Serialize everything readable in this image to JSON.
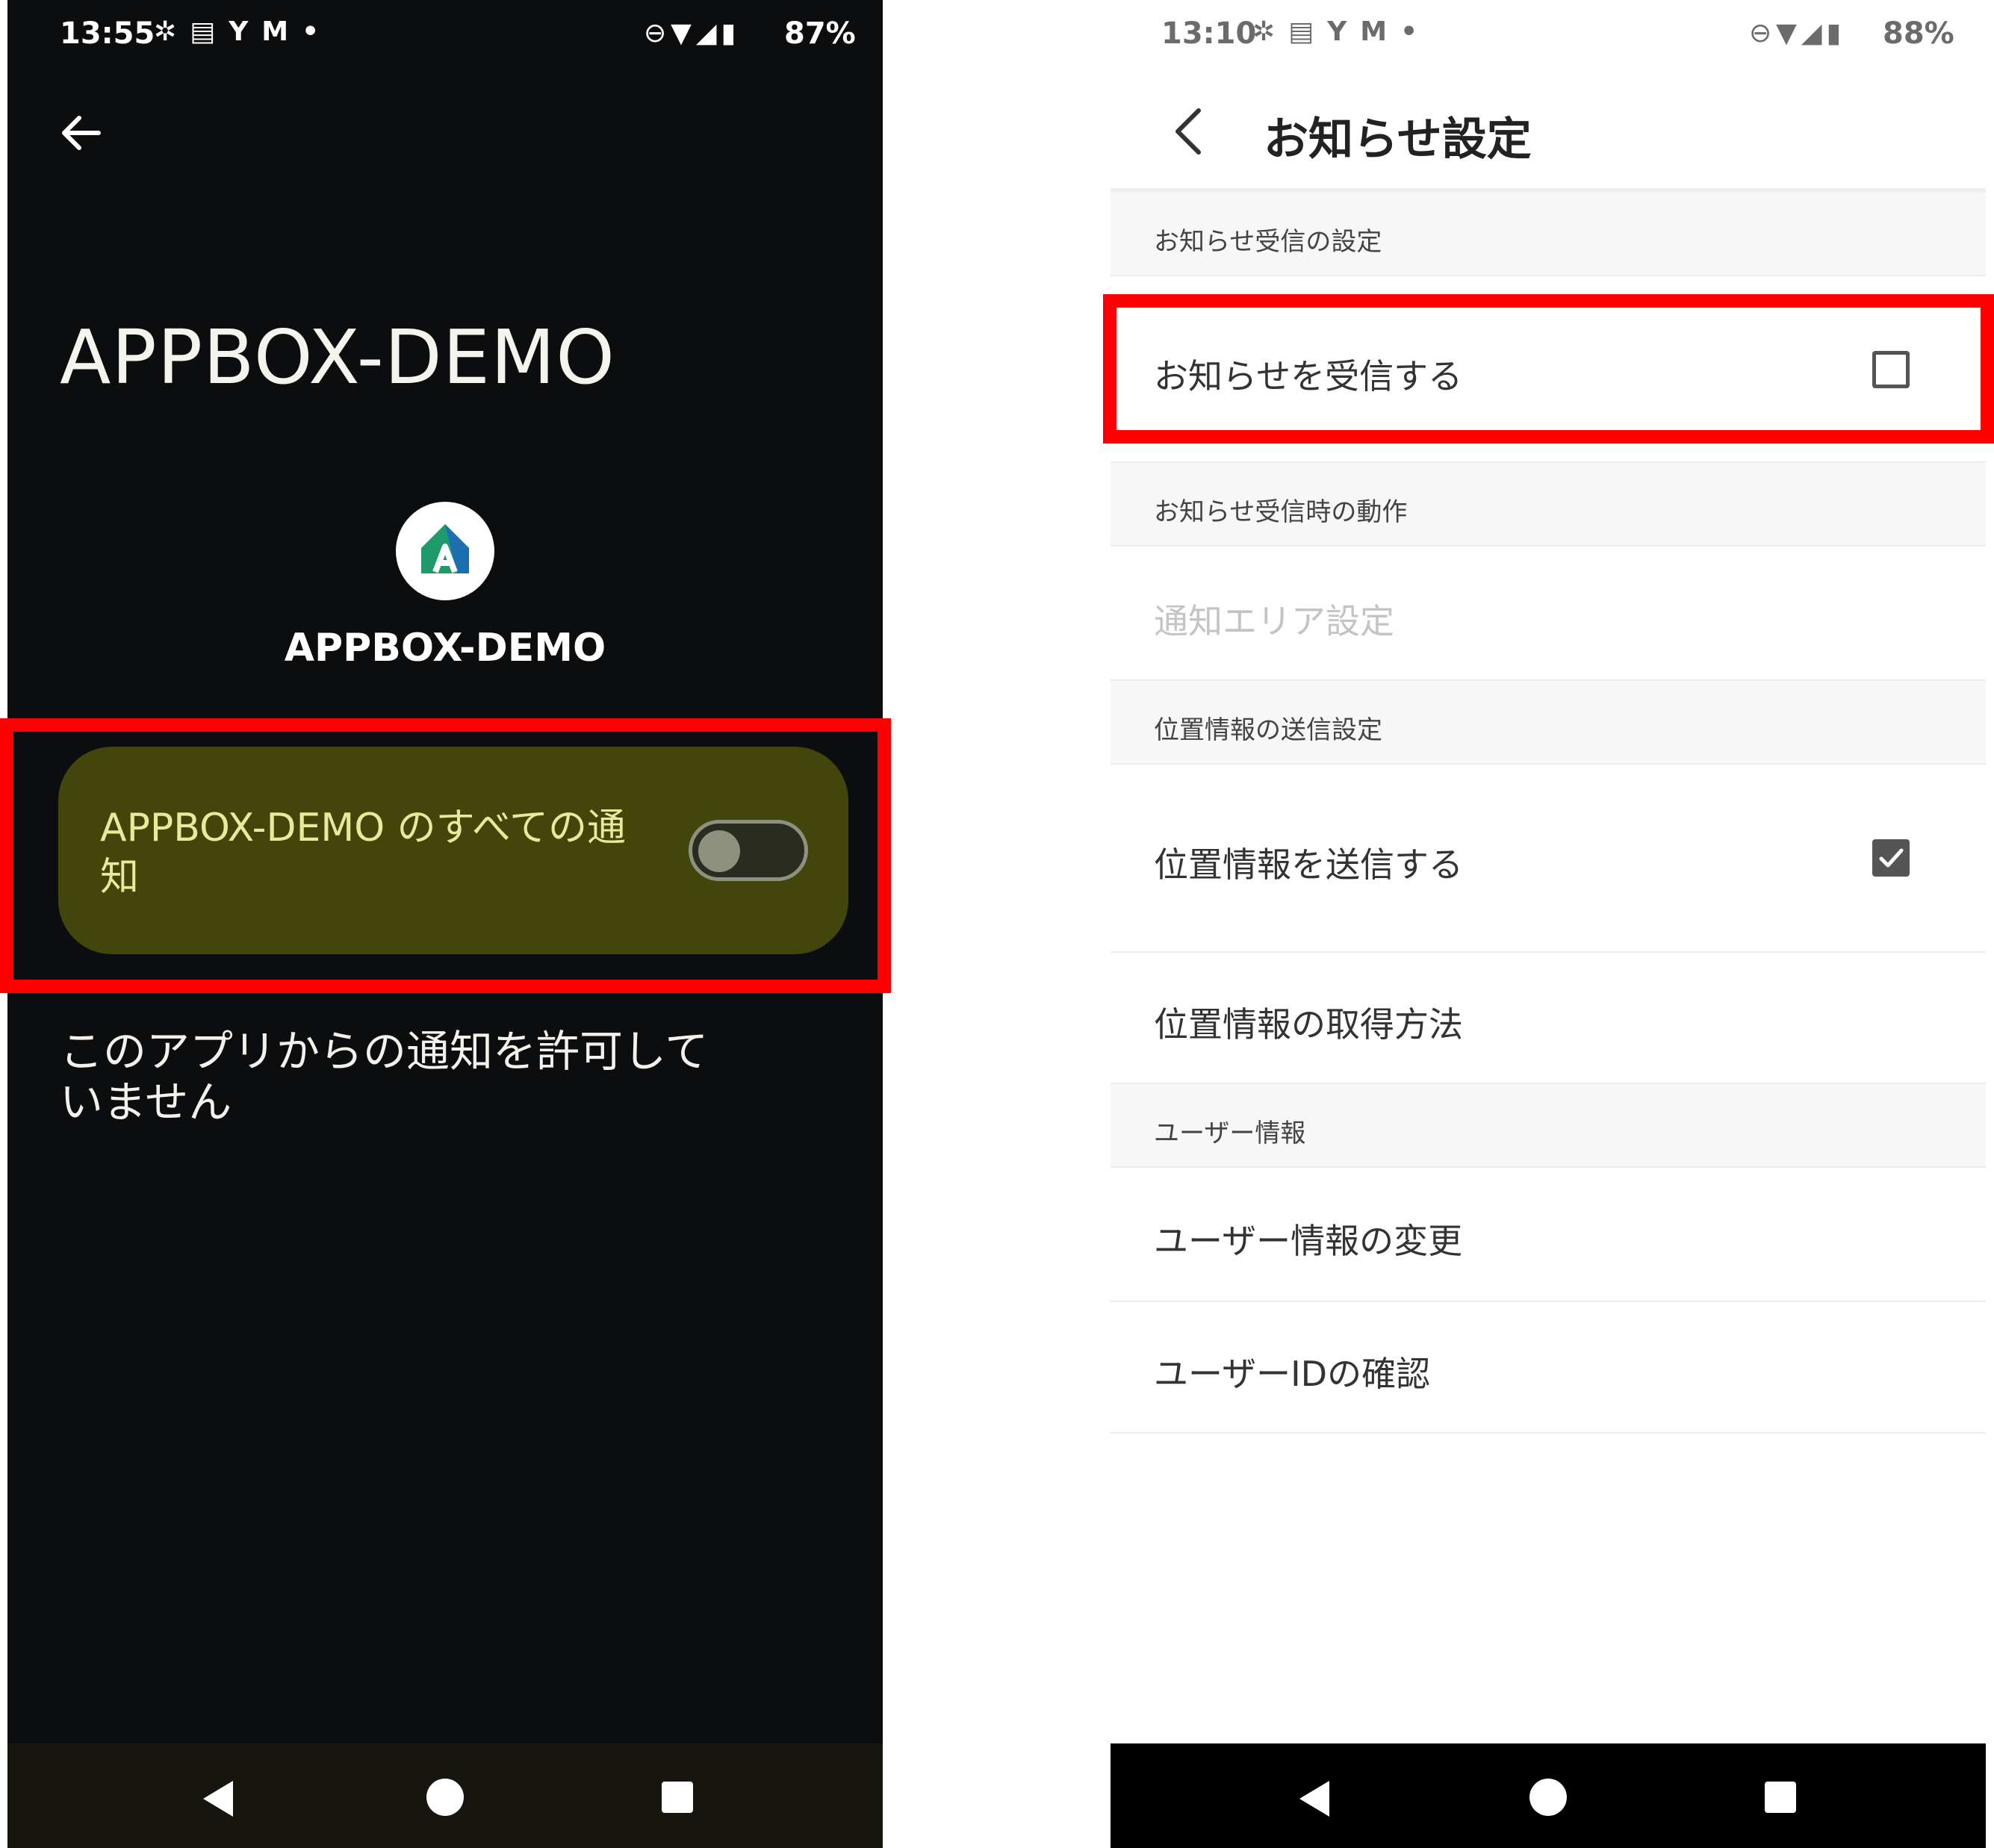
{
  "left_screen": {
    "status": {
      "time": "13:55",
      "battery": "87%"
    },
    "app_title": "APPBOX-DEMO",
    "app_name": "APPBOX-DEMO",
    "all_notifications_label": "APPBOX-DEMO のすべての通知",
    "all_notifications_enabled": false,
    "notice_text": "このアプリからの通知を許可していません"
  },
  "right_screen": {
    "status": {
      "time": "13:10",
      "battery": "88%"
    },
    "title": "お知らせ設定",
    "sections": [
      {
        "header": "お知らせ受信の設定",
        "items": [
          {
            "label": "お知らせを受信する",
            "checked": false
          }
        ]
      },
      {
        "header": "お知らせ受信時の動作",
        "items": [
          {
            "label": "通知エリア設定",
            "disabled": true
          }
        ]
      },
      {
        "header": "位置情報の送信設定",
        "items": [
          {
            "label": "位置情報を送信する",
            "checked": true
          },
          {
            "label": "位置情報の取得方法"
          }
        ]
      },
      {
        "header": "ユーザー情報",
        "items": [
          {
            "label": "ユーザー情報の変更"
          },
          {
            "label": "ユーザーIDの確認"
          }
        ]
      }
    ]
  },
  "colors": {
    "highlight": "#ff0000",
    "dark_bg": "#0c0d0f",
    "toggle_card": "#42460b",
    "toggle_text": "#e6ea9a"
  },
  "icons": [
    "arrow-left-icon",
    "chevron-left-icon",
    "app-logo-icon",
    "wifi-icon",
    "signal-icon",
    "battery-icon",
    "dnd-icon",
    "slack-icon",
    "mail-icon",
    "checkbox-icon"
  ]
}
